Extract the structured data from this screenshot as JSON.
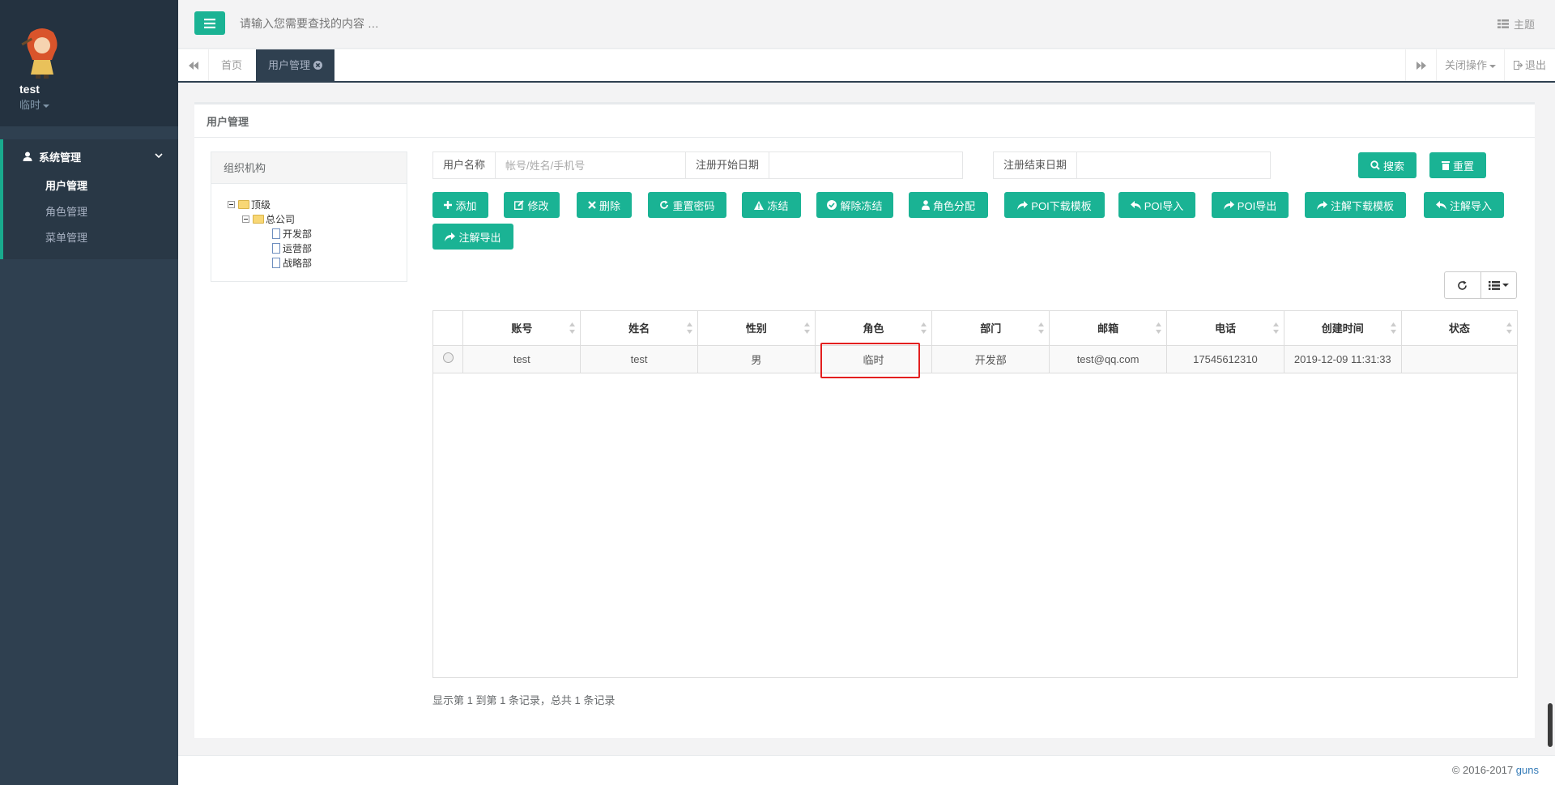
{
  "profile": {
    "name": "test",
    "role": "临时"
  },
  "sidebar": {
    "group": "系统管理",
    "items": [
      {
        "label": "用户管理",
        "active": true
      },
      {
        "label": "角色管理",
        "active": false
      },
      {
        "label": "菜单管理",
        "active": false
      }
    ]
  },
  "topbar": {
    "search_placeholder": "请输入您需要查找的内容 …",
    "theme_label": "主题"
  },
  "tabs": {
    "home": "首页",
    "current": "用户管理",
    "close_ops": "关闭操作",
    "logout": "退出"
  },
  "panel": {
    "title": "用户管理"
  },
  "org": {
    "title": "组织机构",
    "tree": {
      "root": "顶级",
      "company": "总公司",
      "depts": [
        "开发部",
        "运营部",
        "战略部"
      ]
    }
  },
  "filters": {
    "username_label": "用户名称",
    "username_placeholder": "帐号/姓名/手机号",
    "start_label": "注册开始日期",
    "end_label": "注册结束日期",
    "search_btn": "搜索",
    "reset_btn": "重置"
  },
  "toolbar": {
    "add": "添加",
    "edit": "修改",
    "delete": "删除",
    "reset_pwd": "重置密码",
    "freeze": "冻结",
    "unfreeze": "解除冻结",
    "assign_role": "角色分配",
    "poi_template": "POI下载模板",
    "poi_import": "POI导入",
    "poi_export": "POI导出",
    "anno_template": "注解下载模板",
    "anno_import": "注解导入",
    "anno_export": "注解导出"
  },
  "table": {
    "headers": [
      "账号",
      "姓名",
      "性别",
      "角色",
      "部门",
      "邮箱",
      "电话",
      "创建时间",
      "状态"
    ],
    "rows": [
      [
        "test",
        "test",
        "男",
        "临时",
        "开发部",
        "test@qq.com",
        "17545612310",
        "2019-12-09 11:31:33",
        ""
      ]
    ]
  },
  "pagination": {
    "info": "显示第 1 到第 1 条记录，总共 1 条记录"
  },
  "footer": {
    "copyright": "© 2016-2017 ",
    "brand": "guns"
  },
  "colors": {
    "accent": "#1ab394",
    "sidebar": "#2f4050",
    "highlight": "#e31f1f"
  }
}
